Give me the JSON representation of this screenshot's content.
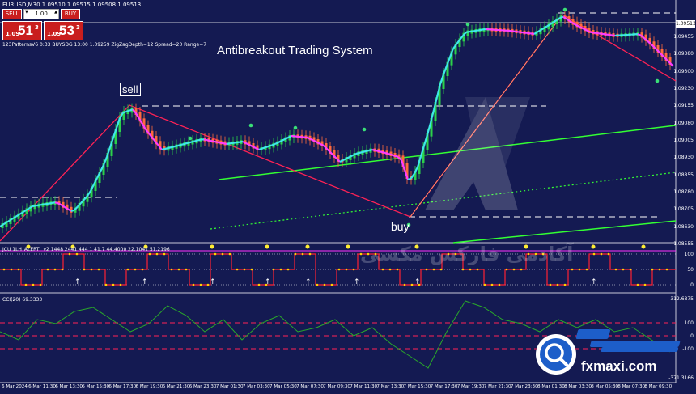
{
  "symbol_bar": "EURUSD,M30  1.09510 1.09515 1.09508 1.09513",
  "trade_panel": {
    "sell_label": "SELL",
    "buy_label": "BUY",
    "lot_value": "1.00",
    "sell_price_prefix": "1.09",
    "sell_price_main": "51",
    "sell_price_sup": "3",
    "buy_price_prefix": "1.09",
    "buy_price_main": "53",
    "buy_price_sup": "3",
    "colors": {
      "button": "#c91e1e"
    }
  },
  "info_line": "123PatternsV6    0:33     BUYSDG  13:00    1.09259  ZigZagDepth=12  Spread=20  Range=7",
  "title": "Antibreakout Trading System",
  "annotations": {
    "sell": "sell",
    "buy": "buy"
  },
  "price_axis": {
    "current_price": "1.09513",
    "labels": [
      "1.09455",
      "1.09380",
      "1.09300",
      "1.09230",
      "1.09155",
      "1.09080",
      "1.09005",
      "1.08930",
      "1.08855",
      "1.08780",
      "1.08705",
      "1.08630",
      "1.08555"
    ]
  },
  "indicator1": {
    "label": "JCU 1LH_ALERT_ v2 1448 2441 444  1 41.7  44.4000  22.1041 51.2196",
    "levels": [
      "100",
      "50",
      "0"
    ]
  },
  "indicator2": {
    "label": "CCI(20) 69.3333",
    "levels": [
      "312.6875",
      "100",
      "0",
      "-100",
      "-371.3166"
    ]
  },
  "time_axis": [
    "6 Mar 2024",
    "6 Mar 11:30",
    "6 Mar 13:30",
    "6 Mar 15:30",
    "6 Mar 17:30",
    "6 Mar 19:30",
    "6 Mar 21:30",
    "6 Mar 23:30",
    "7 Mar 01:30",
    "7 Mar 03:30",
    "7 Mar 05:30",
    "7 Mar 07:30",
    "7 Mar 09:30",
    "7 Mar 11:30",
    "7 Mar 13:30",
    "7 Mar 15:30",
    "7 Mar 17:30",
    "7 Mar 19:30",
    "7 Mar 21:30",
    "7 Mar 23:30",
    "8 Mar 01:30",
    "8 Mar 03:30",
    "8 Mar 05:30",
    "8 Mar 07:30",
    "8 Mar 09:30"
  ],
  "watermark": {
    "brand": "fxmaxi.com",
    "arabic": "آکادمی فارکس مکسی"
  },
  "colors": {
    "background": "#141a52",
    "bull_candle": "#2bd14a",
    "bear_candle": "#ff6a3c",
    "hma_up": "#3ee8e8",
    "hma_down": "#ff3cff",
    "zigzag": "#ff2255",
    "channel": "#33ff33"
  }
}
